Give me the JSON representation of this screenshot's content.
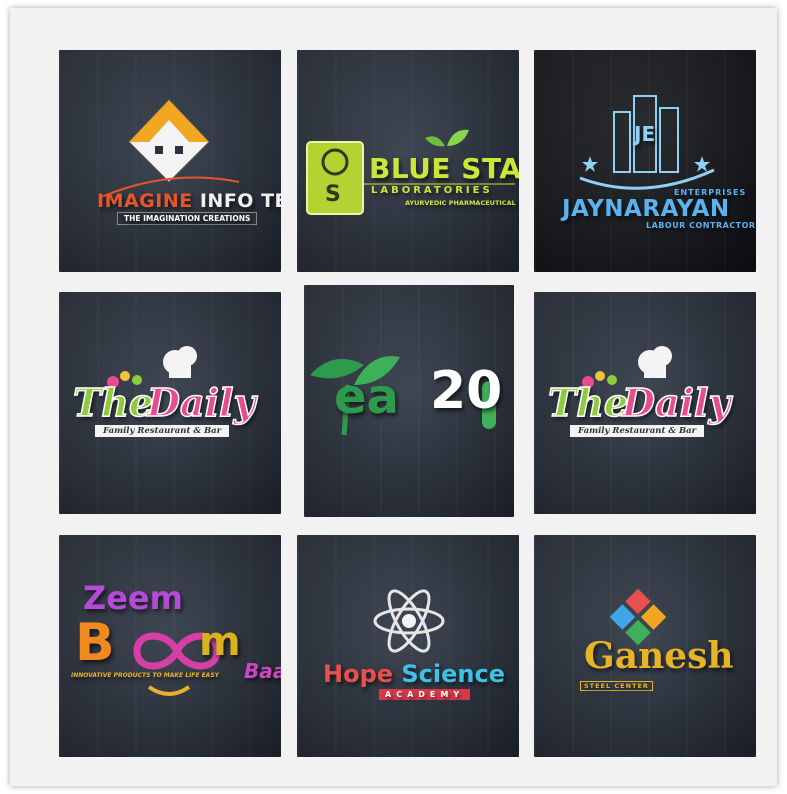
{
  "logos": {
    "imagine": {
      "main_a": "IMAGINE",
      "main_b": " INFO TECH",
      "tagline": "THE IMAGINATION CREATIONS"
    },
    "bluestar": {
      "mark": "S",
      "name": "BLUE STAR",
      "line2": "LABORATORIES",
      "line3": "AYURVEDIC PHARMACEUTICAL"
    },
    "jaynarayan": {
      "monogram": "JE",
      "name": "JAYNARAYAN",
      "enterprises": "ENTERPRISES",
      "tagline": "LABOUR CONTRACTOR"
    },
    "daily_1": {
      "the": "The",
      "daily": "Daily",
      "tagline": "Family Restaurant & Bar"
    },
    "yea20": {
      "word": "ea",
      "number": "20"
    },
    "daily_2": {
      "the": "The",
      "daily": "Daily",
      "tagline": "Family Restaurant & Bar"
    },
    "zeemboom": {
      "zeem": "Zeem",
      "b": "B",
      "m": "m",
      "baa": "Baa",
      "tagline": "INNOVATIVE PRODUCTS TO MAKE LIFE EASY"
    },
    "hope": {
      "hope": "Hope ",
      "science": "Science",
      "academy": "ACADEMY"
    },
    "ganesh": {
      "name": "Ganesh",
      "tagline": "STEEL CENTER"
    }
  },
  "colors": {
    "tile_bg": "#2b323d",
    "imagine_orange": "#e8552a",
    "bluestar_green": "#c9e639",
    "jay_blue": "#5ab2ee",
    "daily_green": "#8ccc3c",
    "daily_pink": "#e94c8b",
    "yea_green": "#2d9a4c",
    "hope_red": "#e84f4f",
    "hope_blue": "#3fc0e8",
    "ganesh_gold": "#e7b428"
  },
  "icons": [
    "house-roof-icon",
    "flask-leaf-icon",
    "building-star-icon",
    "chef-hat-icon",
    "tea-leaf-icon",
    "infinity-icon",
    "atom-icon",
    "diamond-tiles-icon"
  ]
}
